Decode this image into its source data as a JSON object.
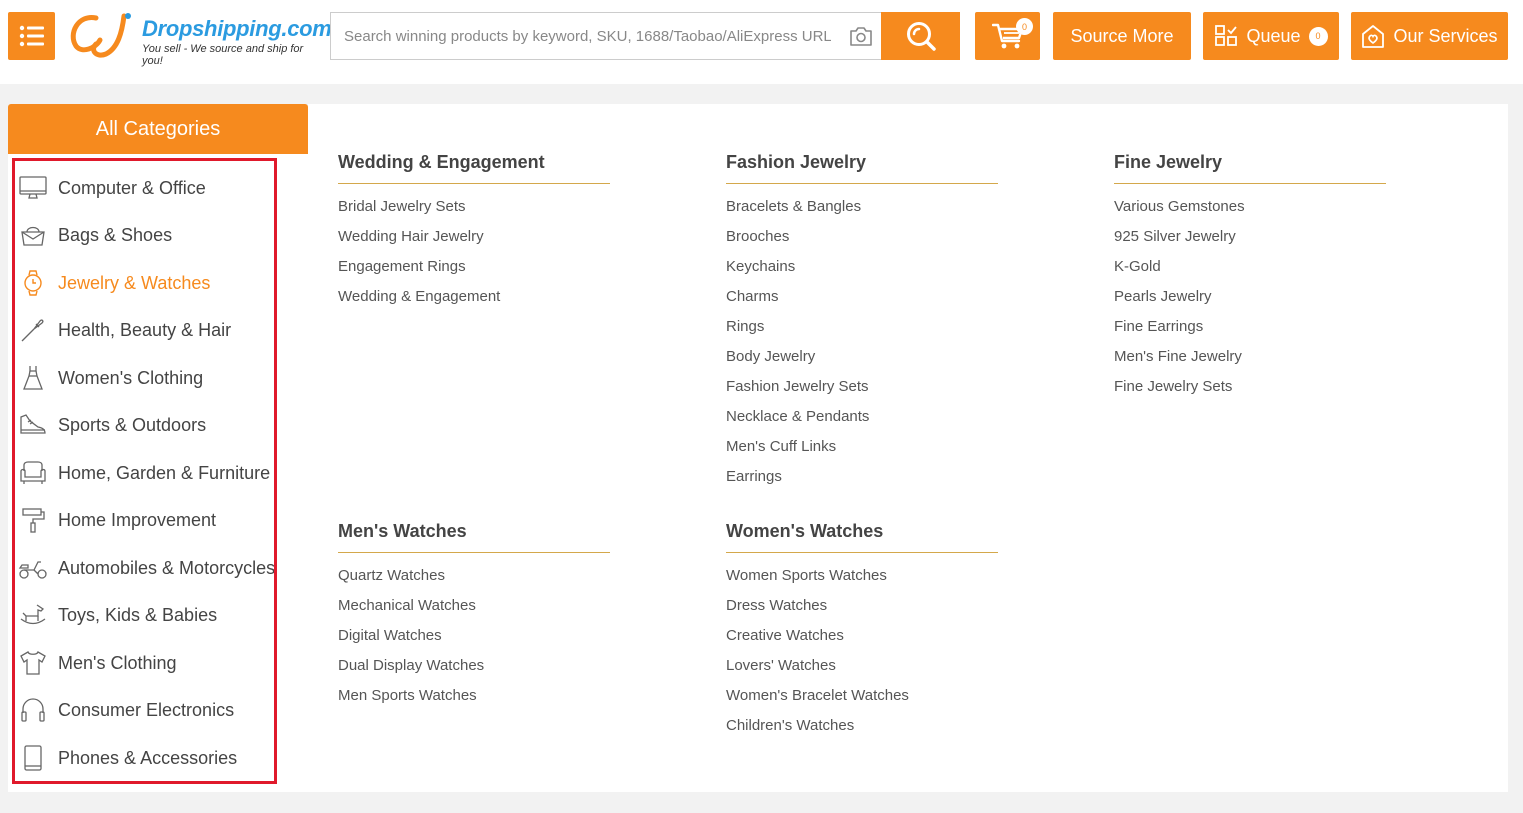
{
  "header": {
    "logo": {
      "name": "Dropshipping.com",
      "tagline": "You sell - We source and ship for you!"
    },
    "search": {
      "placeholder": "Search winning products by keyword, SKU, 1688/Taobao/AliExpress URL"
    },
    "cart_count": "0",
    "source_more_label": "Source More",
    "queue_label": "Queue",
    "queue_count": "0",
    "services_label": "Our Services"
  },
  "sidebar": {
    "title": "All Categories",
    "items": [
      {
        "label": "Computer & Office",
        "icon": "monitor-icon"
      },
      {
        "label": "Bags & Shoes",
        "icon": "bag-icon"
      },
      {
        "label": "Jewelry & Watches",
        "icon": "watch-icon",
        "active": true
      },
      {
        "label": "Health, Beauty & Hair",
        "icon": "brush-icon"
      },
      {
        "label": "Women's Clothing",
        "icon": "dress-icon"
      },
      {
        "label": "Sports & Outdoors",
        "icon": "sneaker-icon"
      },
      {
        "label": "Home, Garden & Furniture",
        "icon": "sofa-icon"
      },
      {
        "label": "Home Improvement",
        "icon": "paint-roller-icon"
      },
      {
        "label": "Automobiles & Motorcycles",
        "icon": "scooter-icon"
      },
      {
        "label": "Toys, Kids & Babies",
        "icon": "rocking-horse-icon"
      },
      {
        "label": "Men's Clothing",
        "icon": "tshirt-icon"
      },
      {
        "label": "Consumer Electronics",
        "icon": "headphones-icon"
      },
      {
        "label": "Phones & Accessories",
        "icon": "phone-icon"
      }
    ]
  },
  "colors": {
    "brand_orange": "#f68a1e",
    "highlight_red": "#e0192b",
    "divider_gold": "#d4a84b"
  },
  "panel": {
    "groups": [
      {
        "title": "Wedding & Engagement",
        "items": [
          "Bridal Jewelry Sets",
          "Wedding Hair Jewelry",
          "Engagement Rings",
          "Wedding & Engagement"
        ]
      },
      {
        "title": "Fashion Jewelry",
        "items": [
          "Bracelets & Bangles",
          "Brooches",
          "Keychains",
          "Charms",
          "Rings",
          "Body Jewelry",
          "Fashion Jewelry Sets",
          "Necklace & Pendants",
          "Men's Cuff Links",
          "Earrings"
        ]
      },
      {
        "title": "Fine Jewelry",
        "items": [
          "Various Gemstones",
          "925 Silver Jewelry",
          "K-Gold",
          "Pearls Jewelry",
          "Fine Earrings",
          "Men's Fine Jewelry",
          "Fine Jewelry Sets"
        ]
      },
      {
        "title": "Men's Watches",
        "items": [
          "Quartz Watches",
          "Mechanical Watches",
          "Digital Watches",
          "Dual Display Watches",
          "Men Sports Watches"
        ]
      },
      {
        "title": "Women's Watches",
        "items": [
          "Women Sports Watches",
          "Dress Watches",
          "Creative Watches",
          "Lovers' Watches",
          "Women's Bracelet Watches",
          "Children's Watches"
        ]
      }
    ]
  }
}
